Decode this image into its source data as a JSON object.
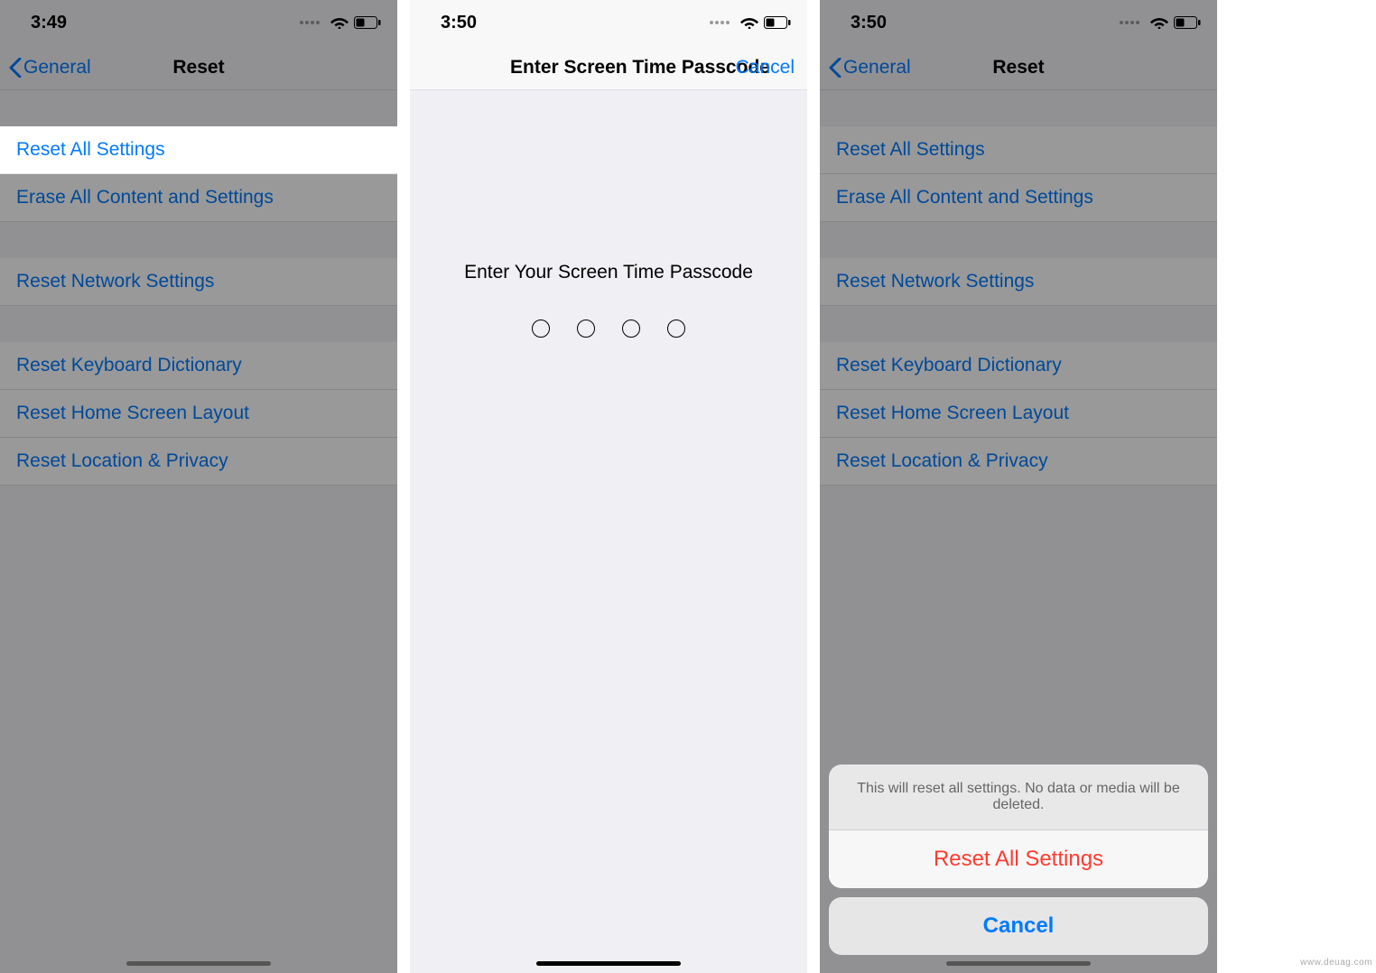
{
  "screens": {
    "left": {
      "time": "3:49",
      "nav": {
        "back": "General",
        "title": "Reset"
      },
      "items": {
        "reset_all": "Reset All Settings",
        "erase_all": "Erase All Content and Settings",
        "reset_network": "Reset Network Settings",
        "reset_keyboard": "Reset Keyboard Dictionary",
        "reset_home": "Reset Home Screen Layout",
        "reset_location": "Reset Location & Privacy"
      }
    },
    "middle": {
      "time": "3:50",
      "nav": {
        "title": "Enter Screen Time Passcode",
        "cancel": "Cancel"
      },
      "prompt": "Enter Your Screen Time Passcode"
    },
    "right": {
      "time": "3:50",
      "nav": {
        "back": "General",
        "title": "Reset"
      },
      "items": {
        "reset_all": "Reset All Settings",
        "erase_all": "Erase All Content and Settings",
        "reset_network": "Reset Network Settings",
        "reset_keyboard": "Reset Keyboard Dictionary",
        "reset_home": "Reset Home Screen Layout",
        "reset_location": "Reset Location & Privacy"
      },
      "sheet": {
        "message": "This will reset all settings. No data or media will be deleted.",
        "confirm": "Reset All Settings",
        "cancel": "Cancel"
      }
    }
  },
  "watermark": "www.deuag.com"
}
